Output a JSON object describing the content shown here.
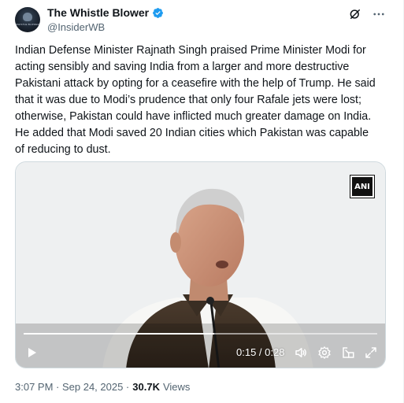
{
  "author": {
    "display_name": "The Whistle Blower",
    "handle": "@InsiderWB",
    "verified": true,
    "avatar_caption": "WHISTLE BLOWER"
  },
  "header_icons": [
    "grok-icon",
    "more-icon"
  ],
  "tweet": {
    "text": "Indian Defense Minister Rajnath Singh praised Prime Minister Modi for\nacting sensibly and saving India from a larger and more destructive\nPakistani attack by opting for a ceasefire with the help of Trump. He said\nthat it was due to Modi’s prudence that only four Rafale jets were lost;\notherwise, Pakistan could have inflicted much greater damage on India.\nHe added that Modi saved 20 Indian cities which Pakistan was capable\nof reducing to dust."
  },
  "video": {
    "watermark": "ANI",
    "current_time": "0:15",
    "duration": "0:28",
    "time_display": "0:15 / 0:28",
    "progress_fraction": 0.54,
    "controls": [
      "play-icon",
      "volume-icon",
      "settings-icon",
      "pip-icon",
      "fullscreen-icon"
    ]
  },
  "meta": {
    "timestamp": "3:07 PM · Sep 24, 2025 ·",
    "views_count": "30.7K",
    "views_label": "Views"
  },
  "colors": {
    "verified_blue": "#1d9bf0",
    "secondary_text": "#536471",
    "primary_text": "#0f1419"
  }
}
